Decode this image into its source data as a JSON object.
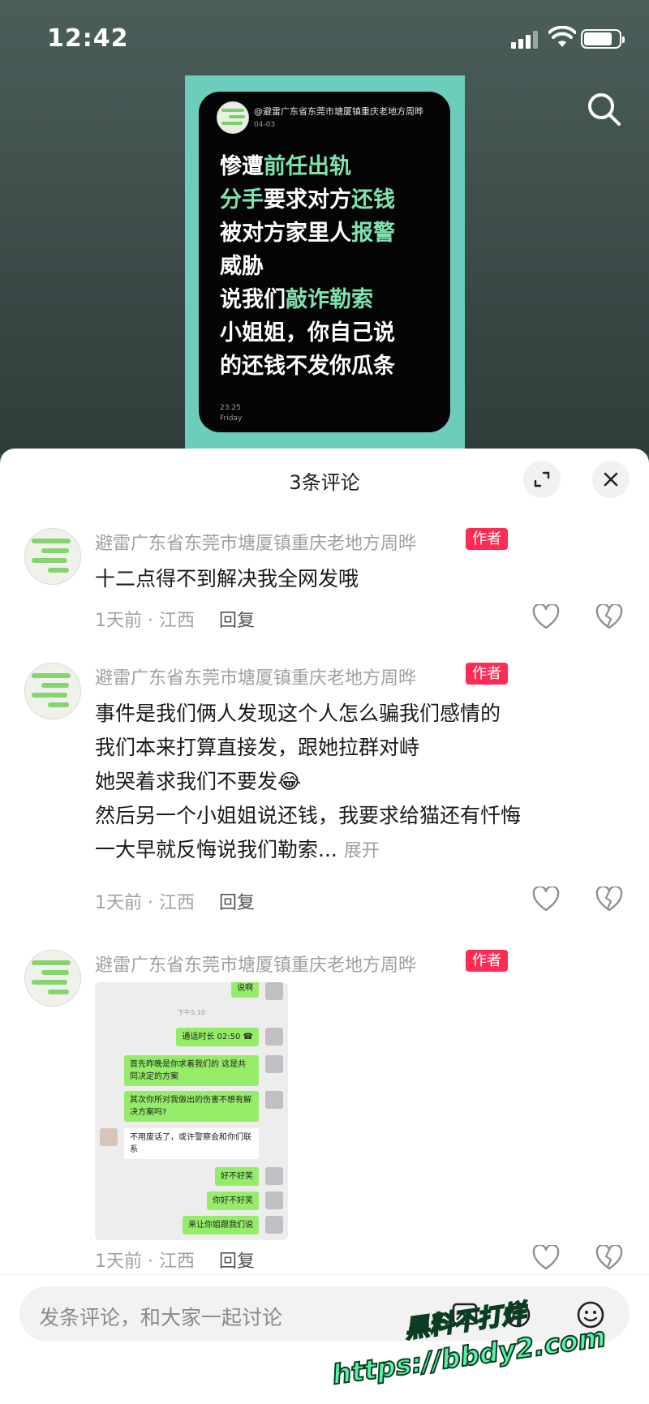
{
  "status_bar": {
    "time": "12:42"
  },
  "post": {
    "handle": "@避雷广东省东莞市塘厦镇重庆老地方周晔",
    "date": "04-03",
    "lines": [
      [
        {
          "t": "惨遭",
          "g": false
        },
        {
          "t": "前任出轨",
          "g": true
        }
      ],
      [
        {
          "t": "分手",
          "g": true
        },
        {
          "t": "要求对方",
          "g": false
        },
        {
          "t": "还钱",
          "g": true
        }
      ],
      [
        {
          "t": "被对方家里人",
          "g": false
        },
        {
          "t": "报警",
          "g": true
        }
      ],
      [
        {
          "t": "威胁",
          "g": false
        }
      ],
      [
        {
          "t": "说我们",
          "g": false
        },
        {
          "t": "敲诈勒索",
          "g": true
        }
      ],
      [
        {
          "t": "小姐姐，你自己说",
          "g": false
        }
      ],
      [
        {
          "t": "的还钱不发你瓜条",
          "g": false
        }
      ]
    ],
    "time": "23:25",
    "day": "Friday"
  },
  "sheet": {
    "title": "3条评论"
  },
  "comments": [
    {
      "name": "避雷广东省东莞市塘厦镇重庆老地方周晔",
      "tag": "作者",
      "lines": [
        "十二点得不到解决我全网发哦"
      ],
      "meta": "1天前 · 江西",
      "reply": "回复"
    },
    {
      "name": "避雷广东省东莞市塘厦镇重庆老地方周晔",
      "tag": "作者",
      "lines": [
        "事件是我们俩人发现这个人怎么骗我们感情的",
        "我们本来打算直接发，跟她拉群对峙",
        "她哭着求我们不要发😂",
        "然后另一个小姐姐说还钱，我要求给猫还有忏悔",
        "一大早就反悔说我们勒索..."
      ],
      "more": "展开",
      "meta": "1天前 · 江西",
      "reply": "回复"
    },
    {
      "name": "避雷广东省东莞市塘厦镇重庆老地方周晔",
      "tag": "作者",
      "image_chat": {
        "top": "说啊",
        "sys": "下午5:10",
        "call": "通话时长 02:50",
        "b1": "首先昨晚是你求着我们的 这是共同决定的方案",
        "b2": "其次你所对我做出的伤害不想有解决方案吗?",
        "w1": "不用废话了，或许警察会和你们联系",
        "b3": "好不好笑",
        "b4": "你好不好笑",
        "b5": "来让你姐跟我们说"
      },
      "meta": "1天前 · 江西",
      "reply": "回复"
    }
  ],
  "input": {
    "placeholder": "发条评论，和大家一起讨论"
  },
  "watermark": {
    "line1": "黑料不打烊",
    "line2": "https://bbdy2.com"
  }
}
